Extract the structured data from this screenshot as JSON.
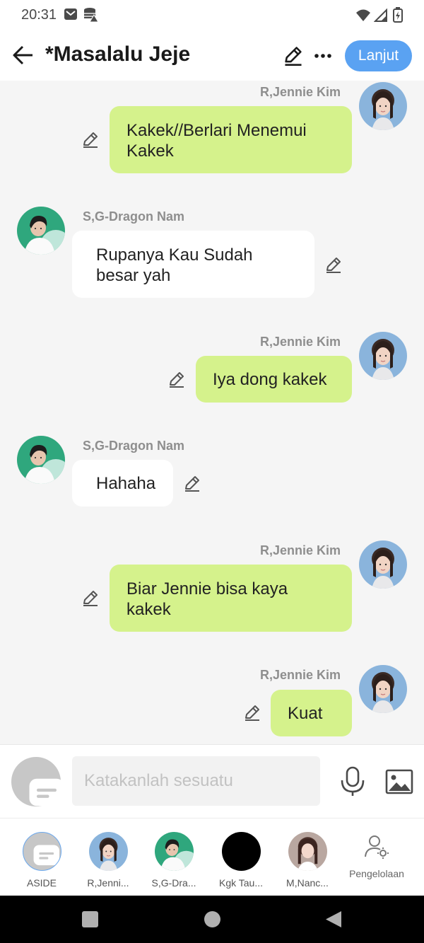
{
  "status": {
    "time": "20:31"
  },
  "header": {
    "title": "*Masalalu Jeje",
    "continue_label": "Lanjut"
  },
  "messages": [
    {
      "sender": "R,Jennie Kim",
      "side": "right",
      "lines": [
        "Kakek//Berlari Menemui",
        "Kakek"
      ]
    },
    {
      "sender": "S,G-Dragon Nam",
      "side": "left",
      "lines": [
        "Rupanya Kau Sudah",
        "besar yah"
      ]
    },
    {
      "sender": "R,Jennie Kim",
      "side": "right",
      "lines": [
        "Iya dong kakek"
      ]
    },
    {
      "sender": "S,G-Dragon Nam",
      "side": "left",
      "lines": [
        "Hahaha"
      ]
    },
    {
      "sender": "R,Jennie Kim",
      "side": "right",
      "lines": [
        "Biar Jennie bisa kaya",
        "kakek"
      ]
    },
    {
      "sender": "R,Jennie Kim",
      "side": "right",
      "lines": [
        "Kuat"
      ]
    }
  ],
  "input": {
    "placeholder": "Katakanlah sesuatu"
  },
  "characters": [
    {
      "label": "ASIDE",
      "icon": "aside-icon"
    },
    {
      "label": "R,Jenni...",
      "icon": "jennie-avatar"
    },
    {
      "label": "S,G-Dra...",
      "icon": "gdragon-avatar"
    },
    {
      "label": "Kgk Tau...",
      "icon": "black-avatar"
    },
    {
      "label": "M,Nanc...",
      "icon": "nancy-avatar"
    }
  ],
  "manager_label": "Pengelolaan",
  "colors": {
    "accent": "#5aa2f2",
    "my_bubble": "#d5f28c",
    "their_bubble": "#ffffff",
    "chat_bg": "#f5f5f5"
  }
}
